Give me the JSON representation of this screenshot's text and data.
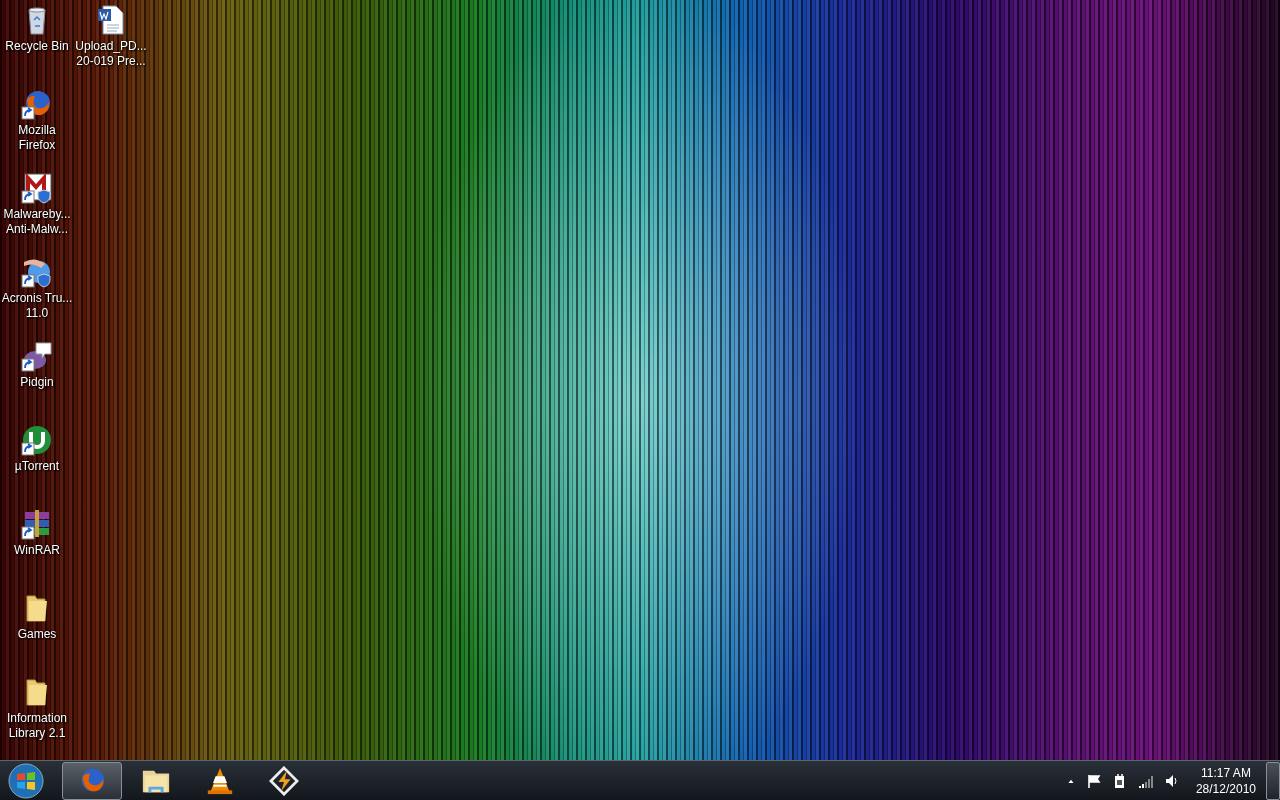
{
  "desktop_icons": [
    {
      "kind": "recycle-bin",
      "label": "Recycle Bin",
      "shortcut": false,
      "shield": false
    },
    {
      "kind": "firefox",
      "label": "Mozilla\nFirefox",
      "shortcut": true,
      "shield": false
    },
    {
      "kind": "malwarebytes",
      "label": "Malwareby...\nAnti-Malw...",
      "shortcut": true,
      "shield": true
    },
    {
      "kind": "acronis",
      "label": "Acronis Tru...\n11.0",
      "shortcut": true,
      "shield": true
    },
    {
      "kind": "pidgin",
      "label": "Pidgin",
      "shortcut": true,
      "shield": false
    },
    {
      "kind": "utorrent",
      "label": "µTorrent",
      "shortcut": true,
      "shield": false
    },
    {
      "kind": "winrar",
      "label": "WinRAR",
      "shortcut": true,
      "shield": false
    },
    {
      "kind": "folder",
      "label": "Games",
      "shortcut": false,
      "shield": false
    },
    {
      "kind": "folder",
      "label": "Information\nLibrary 2.1",
      "shortcut": false,
      "shield": false
    },
    {
      "kind": "word",
      "label": "Upload_PD...\n20-019 Pre...",
      "shortcut": false,
      "shield": false
    }
  ],
  "taskbar": {
    "items": [
      {
        "kind": "firefox",
        "selected": true
      },
      {
        "kind": "explorer",
        "selected": false
      },
      {
        "kind": "vlc",
        "selected": false
      },
      {
        "kind": "winamp",
        "selected": false
      }
    ],
    "tray_icons": [
      {
        "kind": "arrow"
      },
      {
        "kind": "flag"
      },
      {
        "kind": "power"
      },
      {
        "kind": "signal"
      },
      {
        "kind": "volume"
      }
    ],
    "clock": {
      "time": "11:17 AM",
      "date": "28/12/2010"
    }
  }
}
